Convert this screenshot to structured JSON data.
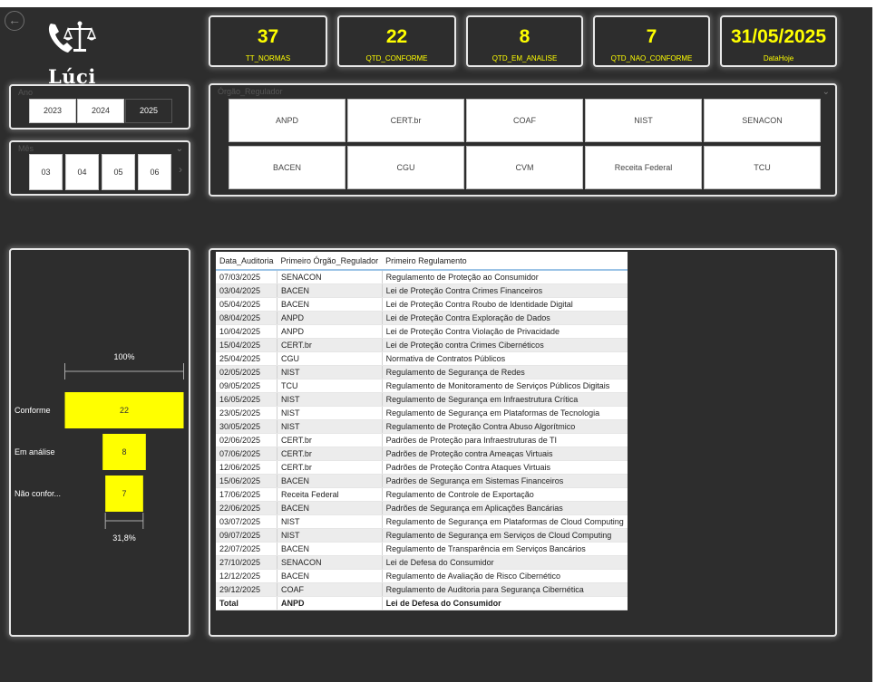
{
  "app": {
    "logo_text": "Lúci",
    "back_icon": "back-arrow-icon"
  },
  "kpis": [
    {
      "value": "37",
      "label": "TT_NORMAS"
    },
    {
      "value": "22",
      "label": "QTD_CONFORME"
    },
    {
      "value": "8",
      "label": "QTD_EM_ANALISE"
    },
    {
      "value": "7",
      "label": "QTD_NAO_CONFORME"
    },
    {
      "value": "31/05/2025",
      "label": "DataHoje"
    }
  ],
  "year_slicer": {
    "title": "Ano",
    "options": [
      "2023",
      "2024",
      "2025"
    ],
    "selected": "2025"
  },
  "month_slicer": {
    "title": "Mês",
    "options": [
      "03",
      "04",
      "05",
      "06"
    ]
  },
  "orgao_slicer": {
    "title": "Órgão_Regulador",
    "options": [
      "ANPD",
      "CERT.br",
      "COAF",
      "NIST",
      "SENACON",
      "BACEN",
      "CGU",
      "CVM",
      "Receita Federal",
      "TCU"
    ]
  },
  "table": {
    "columns": [
      "Data_Auditoria",
      "Primeiro Órgão_Regulador",
      "Primeiro Regulamento"
    ],
    "rows": [
      [
        "07/03/2025",
        "SENACON",
        "Regulamento de Proteção ao Consumidor"
      ],
      [
        "03/04/2025",
        "BACEN",
        "Lei de Proteção Contra Crimes Financeiros"
      ],
      [
        "05/04/2025",
        "BACEN",
        "Lei de Proteção Contra Roubo de Identidade Digital"
      ],
      [
        "08/04/2025",
        "ANPD",
        "Lei de Proteção Contra Exploração de Dados"
      ],
      [
        "10/04/2025",
        "ANPD",
        "Lei de Proteção Contra Violação de Privacidade"
      ],
      [
        "15/04/2025",
        "CERT.br",
        "Lei de Proteção contra Crimes Cibernéticos"
      ],
      [
        "25/04/2025",
        "CGU",
        "Normativa de Contratos Públicos"
      ],
      [
        "02/05/2025",
        "NIST",
        "Regulamento de Segurança de Redes"
      ],
      [
        "09/05/2025",
        "TCU",
        "Regulamento de Monitoramento de Serviços Públicos Digitais"
      ],
      [
        "16/05/2025",
        "NIST",
        "Regulamento de Segurança em Infraestrutura Crítica"
      ],
      [
        "23/05/2025",
        "NIST",
        "Regulamento de Segurança em Plataformas de Tecnologia"
      ],
      [
        "30/05/2025",
        "NIST",
        "Regulamento de Proteção Contra Abuso Algorítmico"
      ],
      [
        "02/06/2025",
        "CERT.br",
        "Padrões de Proteção para Infraestruturas de TI"
      ],
      [
        "07/06/2025",
        "CERT.br",
        "Padrões de Proteção contra Ameaças Virtuais"
      ],
      [
        "12/06/2025",
        "CERT.br",
        "Padrões de Proteção Contra Ataques Virtuais"
      ],
      [
        "15/06/2025",
        "BACEN",
        "Padrões de Segurança em Sistemas Financeiros"
      ],
      [
        "17/06/2025",
        "Receita Federal",
        "Regulamento de Controle de Exportação"
      ],
      [
        "22/06/2025",
        "BACEN",
        "Padrões de Segurança em Aplicações Bancárias"
      ],
      [
        "03/07/2025",
        "NIST",
        "Regulamento de Segurança em Plataformas de Cloud Computing"
      ],
      [
        "09/07/2025",
        "NIST",
        "Regulamento de Segurança em Serviços de Cloud Computing"
      ],
      [
        "22/07/2025",
        "BACEN",
        "Regulamento de Transparência em Serviços Bancários"
      ],
      [
        "27/10/2025",
        "SENACON",
        "Lei de Defesa do Consumidor"
      ],
      [
        "12/12/2025",
        "BACEN",
        "Regulamento de Avaliação de Risco Cibernético"
      ],
      [
        "29/12/2025",
        "COAF",
        "Regulamento de Auditoria para Segurança Cibernética"
      ]
    ],
    "total": [
      "Total",
      "ANPD",
      "Lei de Defesa do Consumidor"
    ]
  },
  "chart_data": {
    "type": "funnel",
    "categories": [
      "Conforme",
      "Em análise",
      "Não confor..."
    ],
    "values": [
      22,
      8,
      7
    ],
    "top_label": "100%",
    "bottom_label": "31,8%",
    "color": "#ffff00"
  }
}
